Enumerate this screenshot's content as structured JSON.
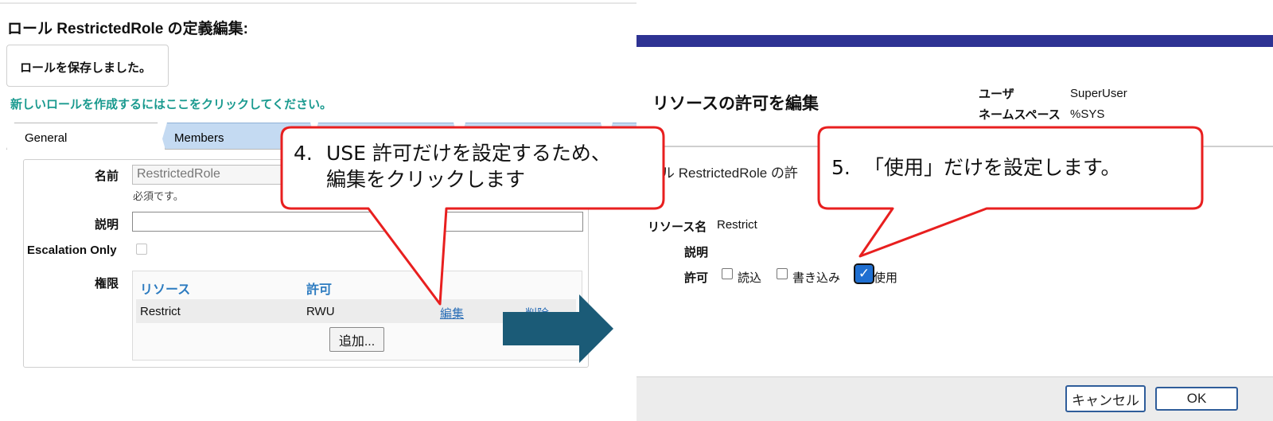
{
  "left": {
    "title": "ロール RestrictedRole の定義編集:",
    "saved_message": "ロールを保存しました。",
    "create_link": "新しいロールを作成するにはここをクリックしてください。",
    "tabs": [
      {
        "label": "General"
      },
      {
        "label": "Members"
      }
    ],
    "form": {
      "name_label": "名前",
      "name_value": "RestrictedRole",
      "required_note": "必須です。",
      "description_label": "説明",
      "escalation_label": "Escalation Only",
      "privileges_label": "権限",
      "table": {
        "headers": [
          "リソース",
          "許可"
        ],
        "row": {
          "resource": "Restrict",
          "permission": "RWU",
          "edit": "編集",
          "delete": "削除"
        }
      },
      "add_button": "追加..."
    }
  },
  "right": {
    "dialog_title": "リソースの許可を編集",
    "user_label": "ユーザ",
    "user_value": "SuperUser",
    "namespace_label": "ネームスペース",
    "namespace_value": "%SYS",
    "subtitle": "ール RestrictedRole の許",
    "resource_name_label": "リソース名",
    "resource_name_value": "Restrict",
    "description_label": "説明",
    "permission_label": "許可",
    "permissions": [
      {
        "label": "読込",
        "checked": false
      },
      {
        "label": "書き込み",
        "checked": false
      },
      {
        "label": "使用",
        "checked": true
      }
    ],
    "cancel_button": "キャンセル",
    "ok_button": "OK"
  },
  "callouts": {
    "step4_number": "4.",
    "step4_line1": "USE 許可だけを設定するため、",
    "step4_line2": "編集をクリックします",
    "step5_number": "5.",
    "step5_text": "「使用」だけを設定します。"
  },
  "colors": {
    "callout_border": "#e81f1f",
    "arrow_fill": "#1b5b77",
    "dialog_bar": "#2e3393",
    "tab_blue": "#c4daf2",
    "link_teal": "#1a9a8f",
    "header_blue": "#2c7bc0"
  }
}
